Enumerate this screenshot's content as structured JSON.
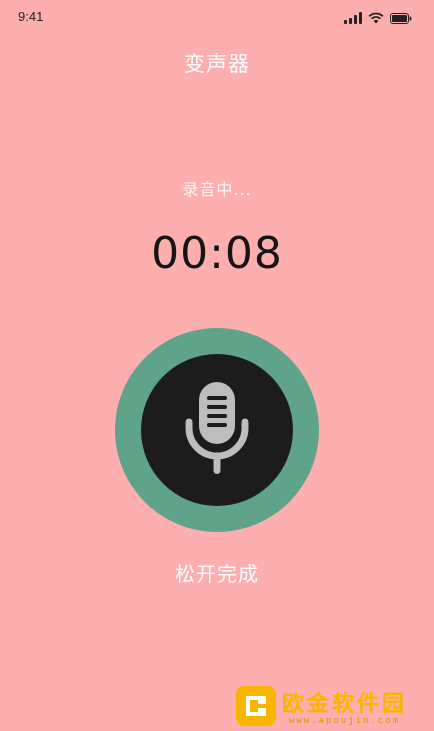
{
  "status_bar": {
    "time": "9:41"
  },
  "header": {
    "title": "变声器"
  },
  "recording": {
    "status": "录音中...",
    "timer": "00:08",
    "release_label": "松开完成"
  },
  "watermark": {
    "name": "欧金软件园",
    "url": "www.apoujin.com"
  },
  "colors": {
    "background": "#fdaeae",
    "ring": "#5fa48a",
    "button_core": "#1c1c1c",
    "watermark": "#f7b500"
  },
  "icons": {
    "record": "microphone-icon"
  }
}
